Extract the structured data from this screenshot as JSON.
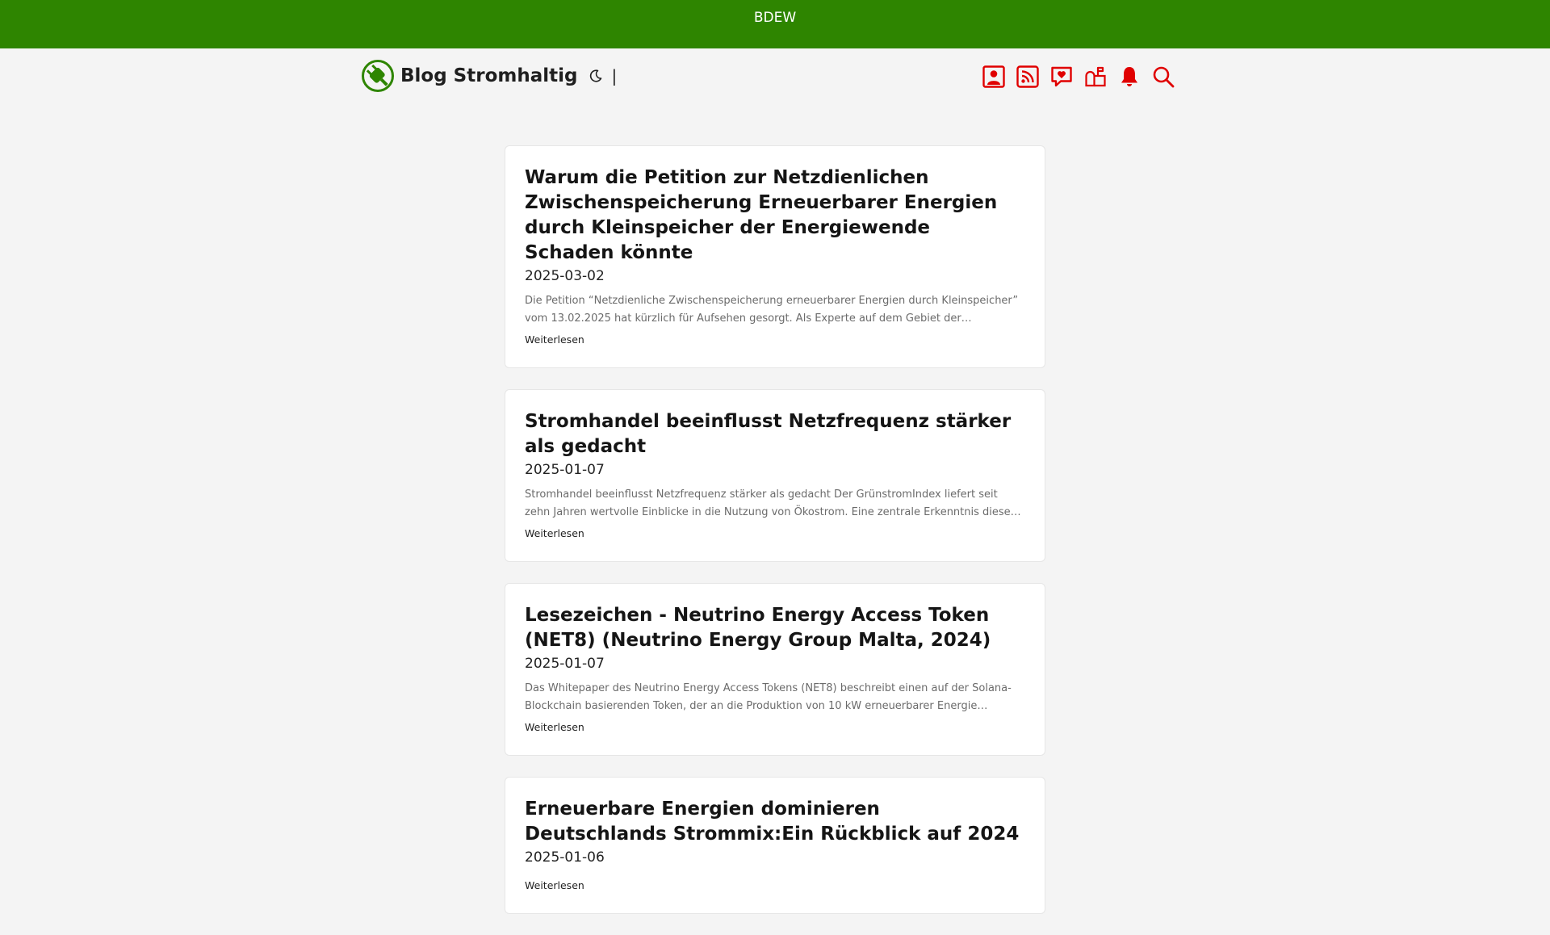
{
  "topbar": {
    "link": "BDEW",
    "color": "#2e8500"
  },
  "header": {
    "site_title": "Blog Stromhaltig",
    "separator": "|",
    "icon_color": "#e00000",
    "actions": [
      {
        "icon": "user-icon"
      },
      {
        "icon": "rss-icon"
      },
      {
        "icon": "heart-message-icon"
      },
      {
        "icon": "mailbox-icon"
      },
      {
        "icon": "bell-icon"
      },
      {
        "icon": "search-icon"
      }
    ]
  },
  "posts": [
    {
      "title": "Warum die Petition zur Netzdienlichen Zwischenspeicherung Erneuerbarer Energien durch Kleinspeicher der Energiewende Schaden könnte",
      "date": "2025-03-02",
      "excerpt": "Die Petition “Netzdienliche Zwischenspeicherung erneuerbarer Energien durch Kleinspeicher” vom 13.02.2025 hat kürzlich für Aufsehen gesorgt. Als Experte auf dem Gebiet der Energiewende…",
      "more": "Weiterlesen"
    },
    {
      "title": "Stromhandel beeinflusst Netzfrequenz stärker als gedacht",
      "date": "2025-01-07",
      "excerpt": "Stromhandel beeinflusst Netzfrequenz stärker als gedacht Der GrünstromIndex liefert seit zehn Jahren wertvolle Einblicke in die Nutzung von Ökostrom. Eine zentrale Erkenntnis dieser Zeit…",
      "more": "Weiterlesen"
    },
    {
      "title": "Lesezeichen - Neutrino Energy Access Token (NET8) (Neutrino Energy Group Malta, 2024)",
      "date": "2025-01-07",
      "excerpt": "Das Whitepaper des Neutrino Energy Access Tokens (NET8) beschreibt einen auf der Solana-Blockchain basierenden Token, der an die Produktion von 10 kW erneuerbarer Energie gebunden…",
      "more": "Weiterlesen"
    },
    {
      "title": "Erneuerbare Energien dominieren Deutschlands Strommix:Ein Rückblick auf 2024",
      "date": "2025-01-06",
      "excerpt": "",
      "more": "Weiterlesen"
    }
  ]
}
